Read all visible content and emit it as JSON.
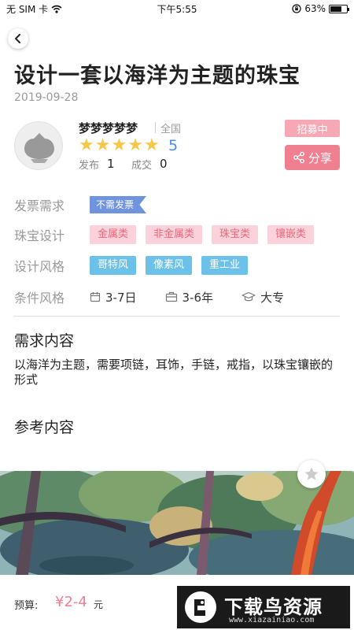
{
  "status_bar": {
    "carrier": "无 SIM 卡",
    "time": "下午5:55",
    "battery_text": "63%"
  },
  "project": {
    "title": "设计一套以海洋为主题的珠宝",
    "date": "2019-09-28"
  },
  "user": {
    "name": "梦梦梦梦梦",
    "region": "全国",
    "rating_stars": 5,
    "rating_value": "5",
    "publish_label": "发布",
    "publish_count": "1",
    "deal_label": "成交",
    "deal_count": "0",
    "status_badge": "招募中",
    "share_label": "分享"
  },
  "details": {
    "invoice": {
      "label": "发票需求",
      "value": "不需发票"
    },
    "jewelry_design": {
      "label": "珠宝设计",
      "tags": [
        "金属类",
        "非金属类",
        "珠宝类",
        "镶嵌类"
      ]
    },
    "design_style": {
      "label": "设计风格",
      "tags": [
        "哥特风",
        "像素风",
        "重工业"
      ]
    },
    "conditions": {
      "label": "条件风格",
      "items": [
        {
          "icon": "calendar-icon",
          "text": "3-7日"
        },
        {
          "icon": "briefcase-icon",
          "text": "3-6年"
        },
        {
          "icon": "graduation-cap-icon",
          "text": "大专"
        }
      ]
    }
  },
  "requirement": {
    "title": "需求内容",
    "text": "以海洋为主题，需要项链，耳饰，手链，戒指，以珠宝镶嵌的形式"
  },
  "reference": {
    "title": "参考内容"
  },
  "budget": {
    "label": "预算:",
    "value": "¥2-4",
    "unit": "元"
  },
  "watermark": {
    "text": "下载鸟资源",
    "url": "www.xiazainiao.com"
  },
  "colors": {
    "accent_pink": "#f0808f",
    "tag_pink_bg": "#fbd2d9",
    "tag_blue_bg": "#6cc1e8",
    "invoice_flag": "#6f93dd",
    "star": "#f5c84a",
    "rating_blue": "#4a8fe7"
  }
}
